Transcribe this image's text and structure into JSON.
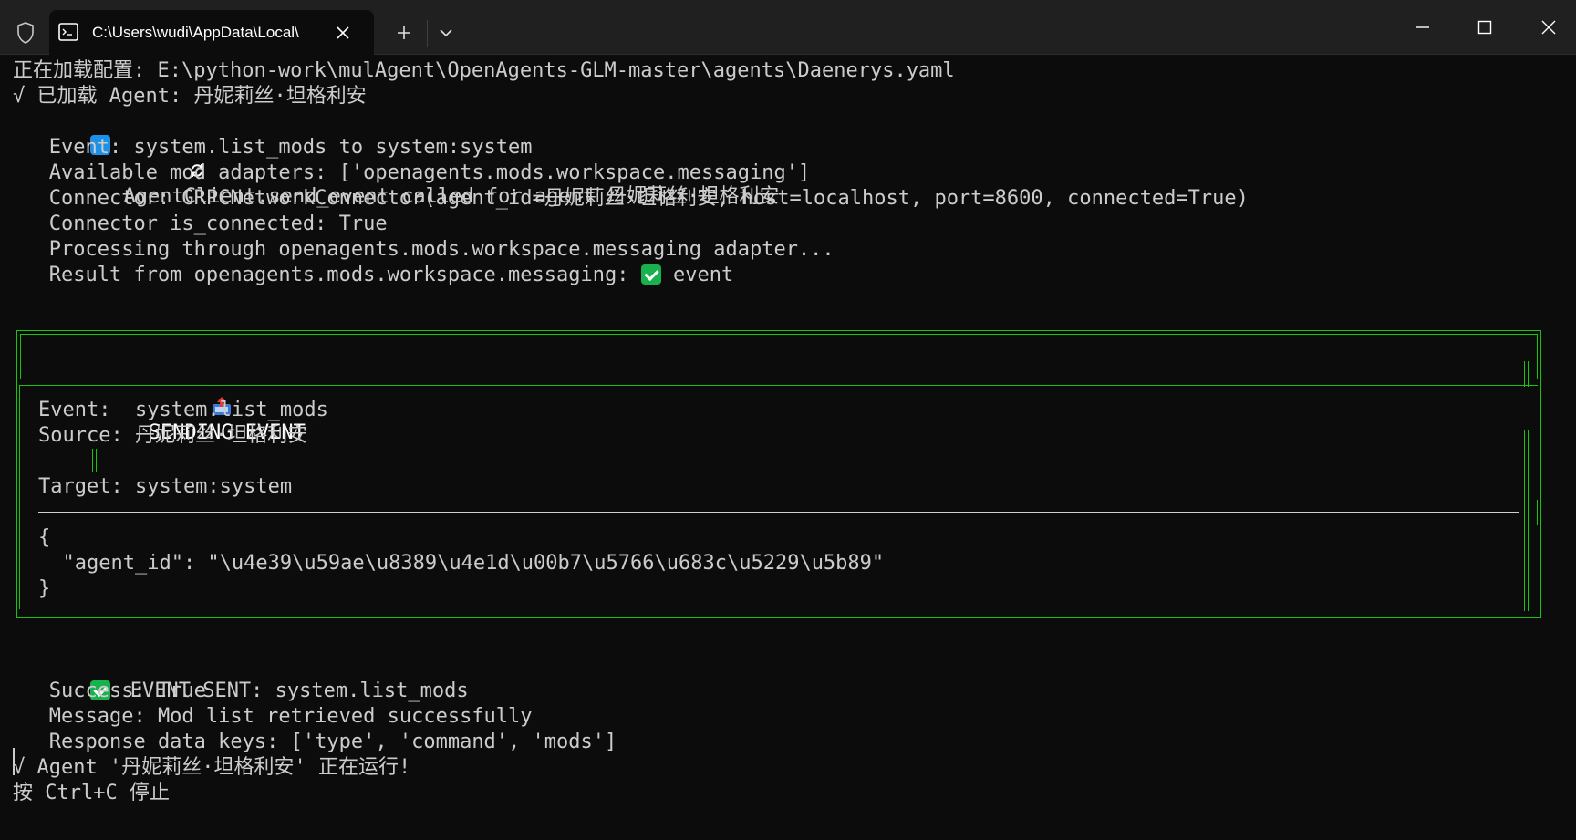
{
  "window": {
    "tab_title": "C:\\Users\\wudi\\AppData\\Local\\",
    "icons": {
      "shield": "shield-icon",
      "tab": "terminal-icon",
      "close_tab": "close-icon",
      "new_tab": "plus-icon",
      "dropdown": "chevron-down-icon",
      "minimize": "minimize-icon",
      "maximize": "maximize-icon",
      "close_window": "close-icon"
    }
  },
  "colors": {
    "background": "#0c0c0c",
    "titlebar": "#202020",
    "text": "#cccccc",
    "panel_border": "#16c60c",
    "check_green": "#17b24e",
    "refresh_blue": "#1e90e8"
  },
  "terminal": {
    "config_line": "正在加载配置: E:\\python-work\\mulAgent\\OpenAgents-GLM-master\\agents\\Daenerys.yaml",
    "loaded_line": "√ 已加载 Agent: 丹妮莉丝·坦格利安",
    "send_event_call": "AgentClient.send_event called for agent 丹妮莉丝·坦格利安",
    "event_line": "   Event: system.list_mods to system:system",
    "adapters_line": "   Available mod adapters: ['openagents.mods.workspace.messaging']",
    "connector_line": "   Connector: GRPCNetworkConnector(agent_id=丹妮莉丝·坦格利安, host=localhost, port=8600, connected=True)",
    "is_connected_line": "   Connector is_connected: True",
    "processing_line": "   Processing through openagents.mods.workspace.messaging adapter...",
    "result_prefix": "   Result from openagents.mods.workspace.messaging: ",
    "result_suffix": " event",
    "panel": {
      "title": " SENDING EVENT",
      "event_line": "Event:  system.list_mods",
      "source_line": "Source: 丹妮莉丝·坦格利安",
      "target_line": "Target: system:system",
      "json_open": "{",
      "json_body": "  \"agent_id\": \"\\u4e39\\u59ae\\u8389\\u4e1d\\u00b7\\u5766\\u683c\\u5229\\u5b89\"",
      "json_close": "}"
    },
    "sent_line": " EVENT SENT: system.list_mods",
    "success_line": "   Success: True",
    "message_line": "   Message: Mod list retrieved successfully",
    "keys_line": "   Response data keys: ['type', 'command', 'mods']",
    "running_line": "√ Agent '丹妮莉丝·坦格利安' 正在运行!",
    "stop_line": "按 Ctrl+C 停止"
  }
}
